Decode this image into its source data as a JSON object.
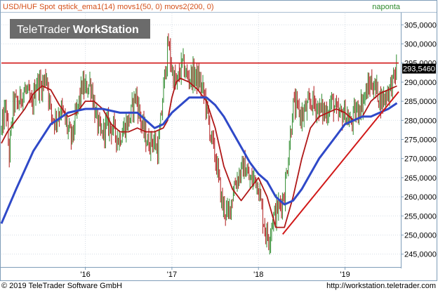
{
  "header": {
    "instrument": "USD/HUF Spot",
    "legend": "qstick_ema1(14) movs1(50, 0) movs2(200, 0)",
    "period": "naponta"
  },
  "logo": {
    "brand": "TeleTrader",
    "product": "WorkStation"
  },
  "footer": {
    "copyright": "© 2019 TeleTrader Software GmbH",
    "url": "http://workstation.teletrader.com"
  },
  "colors": {
    "frame": "#7f9db9",
    "legend_text": "#d4501a",
    "period_text": "#2e8b2e",
    "price_up": "#2e8b2e",
    "price_down": "#b01818",
    "ema": "#b01818",
    "ma200": "#2f49c8",
    "resistance": "#d11818",
    "trendline": "#d11818",
    "last_price_bg": "#000000"
  },
  "chart_data": {
    "type": "line",
    "y_axis": {
      "position": "right",
      "min": 242000,
      "max": 308000,
      "ticks": [
        "245,0000",
        "250,0000",
        "255,0000",
        "260,0000",
        "265,0000",
        "270,0000",
        "275,0000",
        "280,0000",
        "285,0000",
        "290,0000",
        "295,0000",
        "300,0000",
        "305,0000"
      ],
      "tick_values": [
        245000,
        250000,
        255000,
        260000,
        265000,
        270000,
        275000,
        280000,
        285000,
        290000,
        295000,
        300000,
        305000
      ]
    },
    "x_axis": {
      "min": 2015.03,
      "max": 2019.62,
      "ticks": [
        "'16",
        "'17",
        "'18",
        "'19"
      ],
      "tick_values": [
        2016.0,
        2017.0,
        2018.0,
        2019.0
      ]
    },
    "last_price": {
      "label": "293,5460",
      "value": 293546
    },
    "resistance_level": 295000,
    "trendline": {
      "start": [
        2018.28,
        250200
      ],
      "end": [
        2019.62,
        287500
      ]
    },
    "series": [
      {
        "name": "qstick_ema1(14)",
        "style": "ohlc-bars",
        "x": [
          2015.03,
          2015.08,
          2015.12,
          2015.17,
          2015.22,
          2015.27,
          2015.32,
          2015.38,
          2015.43,
          2015.5,
          2015.55,
          2015.6,
          2015.65,
          2015.72,
          2015.78,
          2015.84,
          2015.9,
          2015.96,
          2016.0,
          2016.06,
          2016.12,
          2016.18,
          2016.25,
          2016.32,
          2016.38,
          2016.45,
          2016.52,
          2016.58,
          2016.65,
          2016.72,
          2016.78,
          2016.84,
          2016.88,
          2016.92,
          2016.96,
          2017.0,
          2017.05,
          2017.12,
          2017.18,
          2017.25,
          2017.32,
          2017.38,
          2017.45,
          2017.52,
          2017.58,
          2017.65,
          2017.72,
          2017.78,
          2017.84,
          2017.9,
          2017.96,
          2018.0,
          2018.04,
          2018.08,
          2018.12,
          2018.16,
          2018.2,
          2018.25,
          2018.3,
          2018.35,
          2018.4,
          2018.45,
          2018.5,
          2018.55,
          2018.62,
          2018.7,
          2018.78,
          2018.85,
          2018.92,
          2019.0,
          2019.06,
          2019.12,
          2019.18,
          2019.24,
          2019.3,
          2019.36,
          2019.42,
          2019.48,
          2019.55,
          2019.6
        ],
        "y": [
          277000,
          284000,
          271000,
          285000,
          284000,
          287000,
          288000,
          283000,
          290000,
          289000,
          292000,
          282000,
          280000,
          283000,
          279000,
          275000,
          282000,
          289000,
          288000,
          290000,
          281000,
          276000,
          279000,
          278000,
          275000,
          278000,
          281000,
          287000,
          279000,
          274000,
          275000,
          272000,
          282000,
          293000,
          300000,
          293000,
          289000,
          295000,
          291000,
          292000,
          290000,
          286000,
          276000,
          268000,
          258000,
          255000,
          263000,
          266000,
          268000,
          264000,
          265000,
          263000,
          256000,
          251000,
          249000,
          254000,
          256000,
          258000,
          261000,
          272000,
          284000,
          283000,
          281000,
          283000,
          285000,
          283000,
          282000,
          285000,
          281000,
          282000,
          279000,
          282000,
          284000,
          287000,
          290000,
          288000,
          285000,
          287000,
          290000,
          293546
        ]
      },
      {
        "name": "movs1(50, 0)",
        "style": "line",
        "x": [
          2015.03,
          2015.1,
          2015.2,
          2015.3,
          2015.4,
          2015.5,
          2015.6,
          2015.7,
          2015.8,
          2015.9,
          2016.0,
          2016.1,
          2016.2,
          2016.3,
          2016.4,
          2016.5,
          2016.6,
          2016.7,
          2016.8,
          2016.9,
          2016.95,
          2017.0,
          2017.05,
          2017.1,
          2017.2,
          2017.3,
          2017.4,
          2017.5,
          2017.6,
          2017.7,
          2017.8,
          2017.9,
          2018.0,
          2018.1,
          2018.2,
          2018.3,
          2018.4,
          2018.5,
          2018.6,
          2018.7,
          2018.8,
          2018.9,
          2019.0,
          2019.1,
          2019.2,
          2019.3,
          2019.4,
          2019.5,
          2019.6
        ],
        "y": [
          274000,
          277000,
          280000,
          283000,
          287000,
          289000,
          288000,
          284000,
          281000,
          282000,
          285000,
          285000,
          283000,
          279000,
          277000,
          277000,
          278000,
          277000,
          277000,
          278000,
          280000,
          286000,
          290000,
          291000,
          290000,
          288000,
          285000,
          278000,
          268000,
          262000,
          259000,
          262000,
          265000,
          260000,
          252000,
          252000,
          260000,
          270000,
          278000,
          281000,
          282000,
          283000,
          282000,
          280000,
          281000,
          285000,
          287000,
          288000,
          289000
        ]
      },
      {
        "name": "movs2(200, 0)",
        "style": "line",
        "x": [
          2015.03,
          2015.2,
          2015.4,
          2015.6,
          2015.8,
          2016.0,
          2016.2,
          2016.4,
          2016.6,
          2016.8,
          2016.9,
          2017.0,
          2017.2,
          2017.4,
          2017.5,
          2017.6,
          2017.7,
          2017.8,
          2017.9,
          2018.0,
          2018.1,
          2018.2,
          2018.3,
          2018.4,
          2018.5,
          2018.6,
          2018.7,
          2018.8,
          2018.9,
          2019.0,
          2019.1,
          2019.2,
          2019.3,
          2019.4,
          2019.5,
          2019.6
        ],
        "y": [
          253000,
          262000,
          272000,
          279000,
          282000,
          283000,
          283000,
          282000,
          282000,
          278000,
          279000,
          282000,
          286000,
          286000,
          284000,
          281000,
          277000,
          273000,
          269000,
          266000,
          264000,
          260000,
          258000,
          259000,
          262000,
          266000,
          270000,
          273000,
          276000,
          279000,
          280000,
          281000,
          281000,
          282000,
          283000,
          284500
        ]
      }
    ]
  }
}
